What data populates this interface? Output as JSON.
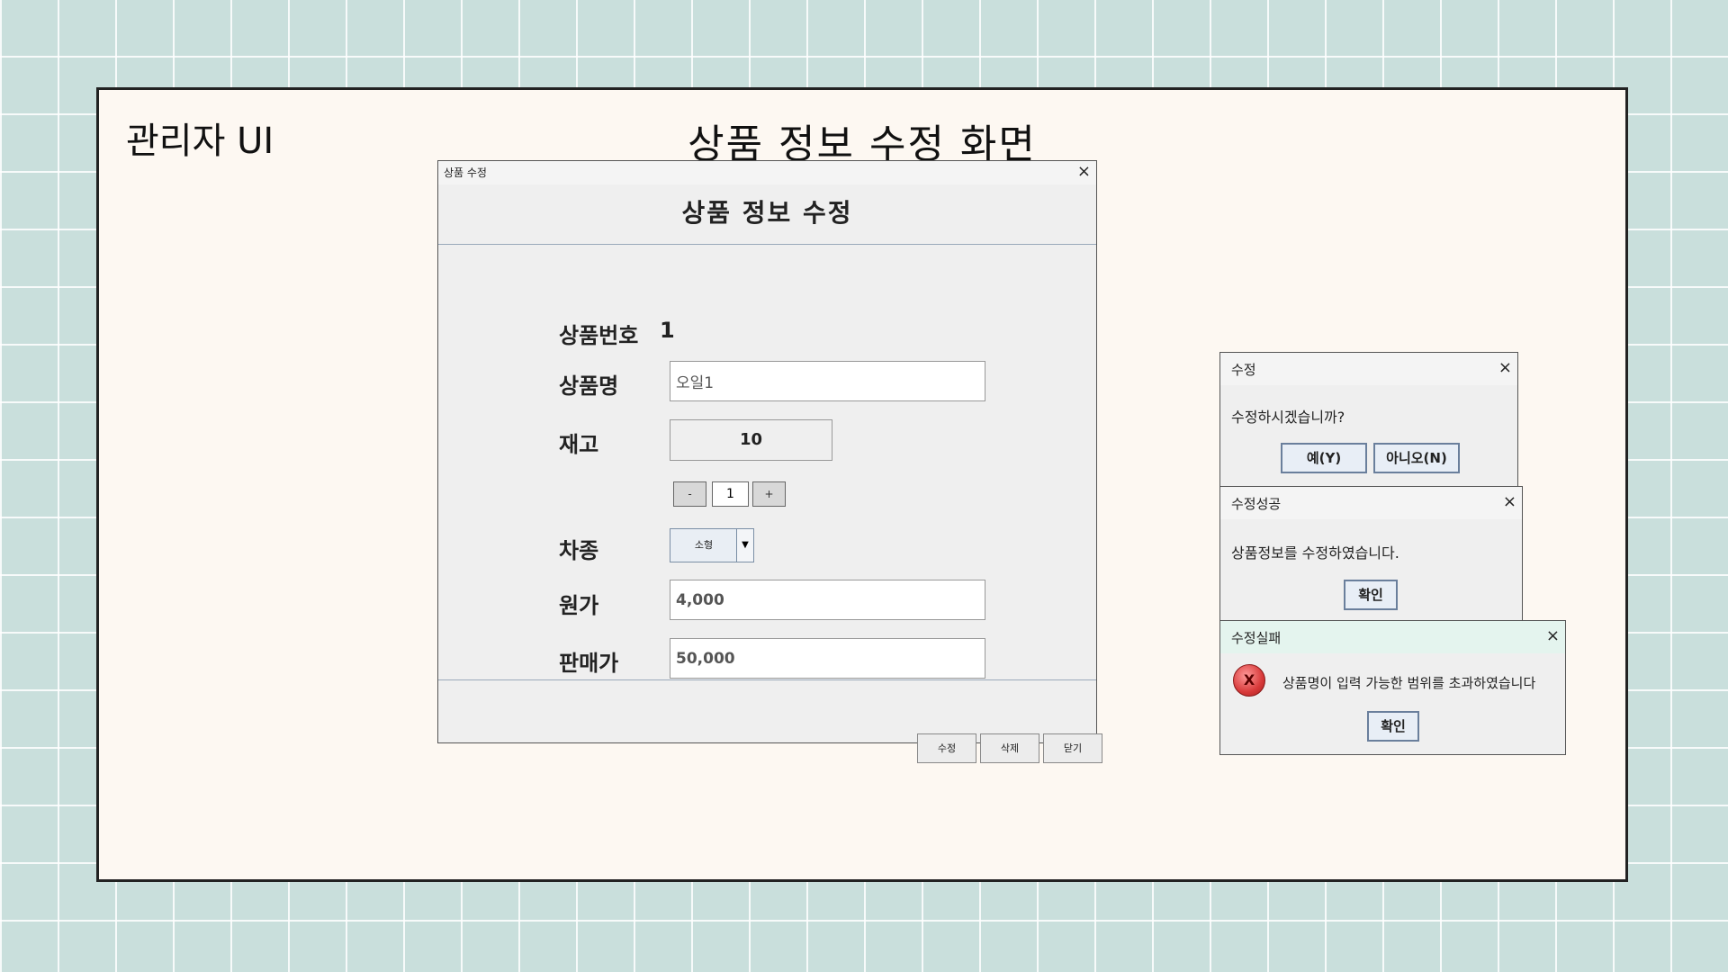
{
  "slide": {
    "label": "관리자 UI",
    "title": "상품 정보 수정 화면"
  },
  "main_window": {
    "title": "상품 수정",
    "close_icon": "×",
    "heading": "상품 정보 수정",
    "product_no_label": "상품번호",
    "product_no_value": "1",
    "name_label": "상품명",
    "name_value": "오일1",
    "stock_label": "재고",
    "stock_value": "10",
    "stepper": {
      "minus": "-",
      "value": "1",
      "plus": "+"
    },
    "type_label": "차종",
    "type_value": "소형",
    "cost_label": "원가",
    "cost_value": "4,000",
    "price_label": "판매가",
    "price_value": "50,000",
    "buttons": {
      "edit": "수정",
      "delete": "삭제",
      "close": "닫기"
    }
  },
  "confirm_dialog": {
    "title": "수정",
    "close_icon": "×",
    "message": "수정하시겠습니까?",
    "yes": "예(Y)",
    "no": "아니오(N)"
  },
  "success_dialog": {
    "title": "수정성공",
    "close_icon": "×",
    "message": "상품정보를 수정하였습니다.",
    "ok": "확인"
  },
  "error_dialog": {
    "title": "수정실패",
    "close_icon": "×",
    "icon": "X",
    "message": "상품명이 입력 가능한 범위를 초과하였습니다",
    "ok": "확인"
  },
  "colors": {
    "background": "#c9dfdc",
    "slide": "#fdf8f2",
    "error_title_bar": "#e4f4ee"
  }
}
